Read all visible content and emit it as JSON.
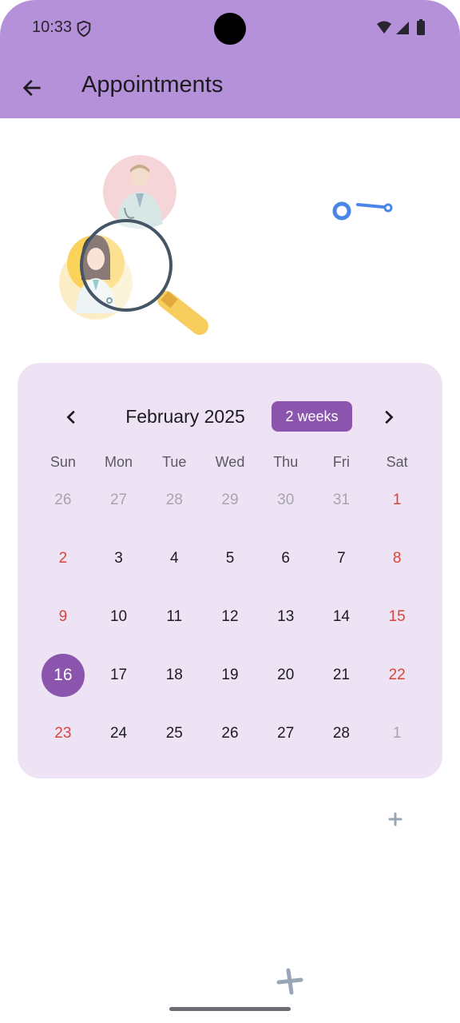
{
  "status_bar": {
    "time": "10:33",
    "icons": [
      "shield-icon",
      "wifi-icon",
      "signal-icon",
      "battery-icon"
    ]
  },
  "app_bar": {
    "back_icon": "arrow-left-icon",
    "title": "Appointments"
  },
  "calendar": {
    "month_label": "February 2025",
    "format_button": "2 weeks",
    "prev_icon": "chevron-left-icon",
    "next_icon": "chevron-right-icon",
    "weekdays": [
      "Sun",
      "Mon",
      "Tue",
      "Wed",
      "Thu",
      "Fri",
      "Sat"
    ],
    "selected_day": "16",
    "weeks": [
      [
        "26",
        "27",
        "28",
        "29",
        "30",
        "31",
        "1"
      ],
      [
        "2",
        "3",
        "4",
        "5",
        "6",
        "7",
        "8"
      ],
      [
        "9",
        "10",
        "11",
        "12",
        "13",
        "14",
        "15"
      ],
      [
        "16",
        "17",
        "18",
        "19",
        "20",
        "21",
        "22"
      ],
      [
        "23",
        "24",
        "25",
        "26",
        "27",
        "28",
        "1"
      ]
    ]
  },
  "colors": {
    "app_bar": "#b591d9",
    "card": "#ede3f4",
    "accent": "#8b55ad",
    "weekend": "#d9453a",
    "outside_day": "#a8a4ad"
  }
}
